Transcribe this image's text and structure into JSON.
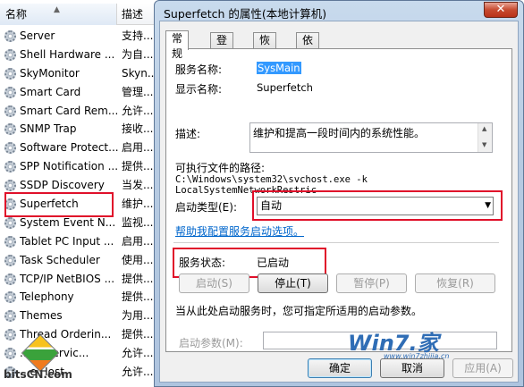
{
  "services_list": {
    "header": {
      "name": "名称",
      "desc": "描述"
    },
    "rows": [
      {
        "name": "Server",
        "desc": "支持..."
      },
      {
        "name": "Shell Hardware ...",
        "desc": "为自..."
      },
      {
        "name": "SkyMonitor",
        "desc": "Skyn..."
      },
      {
        "name": "Smart Card",
        "desc": "管理..."
      },
      {
        "name": "Smart Card Rem...",
        "desc": "允许..."
      },
      {
        "name": "SNMP Trap",
        "desc": "接收..."
      },
      {
        "name": "Software Protect...",
        "desc": "启用..."
      },
      {
        "name": "SPP Notification ...",
        "desc": "提供..."
      },
      {
        "name": "SSDP Discovery",
        "desc": "当发..."
      },
      {
        "name": "Superfetch",
        "desc": "维护..."
      },
      {
        "name": "System Event N...",
        "desc": "监视..."
      },
      {
        "name": "Tablet PC Input ...",
        "desc": "启用..."
      },
      {
        "name": "Task Scheduler",
        "desc": "使用..."
      },
      {
        "name": "TCP/IP NetBIOS ...",
        "desc": "提供..."
      },
      {
        "name": "Telephony",
        "desc": "提供..."
      },
      {
        "name": "Themes",
        "desc": "为用..."
      },
      {
        "name": "Thread Orderin...",
        "desc": "提供..."
      },
      {
        "name": "...se Servic...",
        "desc": "允许..."
      },
      {
        "name": "...e Host",
        "desc": "允许..."
      }
    ]
  },
  "logo_bits": "bitsCN.com",
  "dialog": {
    "title": "Superfetch 的属性(本地计算机)",
    "close": "✕",
    "tabs": [
      "常规",
      "登录",
      "恢复",
      "依存关系"
    ],
    "service_name_label": "服务名称:",
    "service_name_value": "SysMain",
    "display_name_label": "显示名称:",
    "display_name_value": "Superfetch",
    "description_label": "描述:",
    "description_value": "维护和提高一段时间内的系统性能。",
    "exe_path_label": "可执行文件的路径:",
    "exe_path_value": "C:\\Windows\\system32\\svchost.exe -k LocalSystemNetworkRestric",
    "startup_type_label": "启动类型(E):",
    "startup_type_value": "自动",
    "help_link": "帮助我配置服务启动选项。",
    "status_label": "服务状态:",
    "status_value": "已启动",
    "buttons": {
      "start": "启动(S)",
      "stop": "停止(T)",
      "pause": "暂停(P)",
      "resume": "恢复(R)"
    },
    "hint_text": "当从此处启动服务时，您可指定所适用的启动参数。",
    "params_label": "启动参数(M):",
    "params_value": "",
    "footer": {
      "ok": "确定",
      "cancel": "取消",
      "apply": "应用(A)"
    }
  },
  "win7_logo": {
    "main": "Win7.家",
    "sub": "www.win7zhijia.cn"
  }
}
